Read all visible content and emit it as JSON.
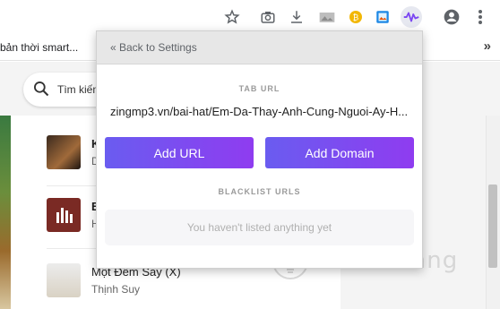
{
  "toolbar": {
    "icons": [
      "star-icon",
      "camera-icon",
      "download-icon",
      "reader-icon",
      "coin-icon",
      "image-icon",
      "extension-wave-icon",
      "profile-icon",
      "menu-icon"
    ]
  },
  "bookmarks": {
    "text": "bản thời smart...",
    "more": "»"
  },
  "page": {
    "search_placeholder": "Tìm kiếm",
    "songs": [
      {
        "title": "K",
        "artist": "D"
      },
      {
        "title": "E",
        "artist": "H"
      },
      {
        "title": "Một Đêm Say (X)",
        "artist": "Thịnh Suy"
      }
    ]
  },
  "watermark": {
    "text": "uantrimang"
  },
  "popup": {
    "back_label": "« Back to Settings",
    "tab_url_label": "TAB URL",
    "tab_url_value": "zingmp3.vn/bai-hat/Em-Da-Thay-Anh-Cung-Nguoi-Ay-H...",
    "add_url_label": "Add URL",
    "add_domain_label": "Add Domain",
    "blacklist_label": "BLACKLIST URLS",
    "empty_message": "You haven't listed anything yet"
  },
  "colors": {
    "button_gradient_start": "#6a5cf0",
    "button_gradient_end": "#8f3cf0",
    "header_bg": "#e7e7e7"
  }
}
